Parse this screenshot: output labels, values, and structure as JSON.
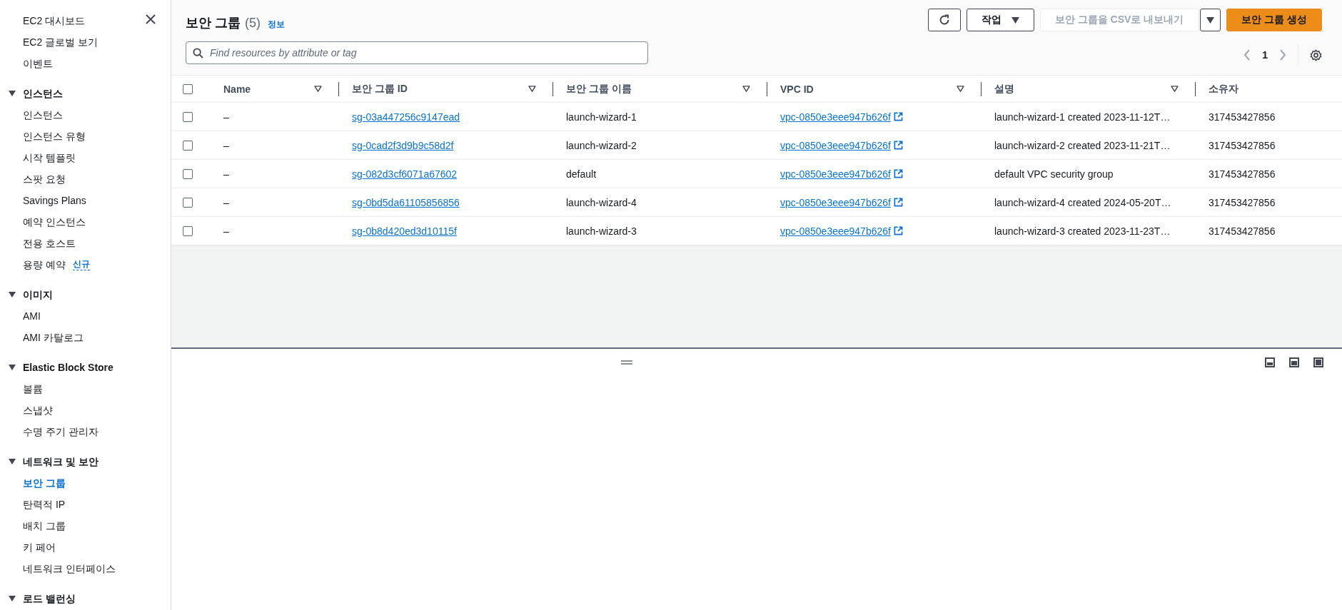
{
  "sidebar": {
    "top_items": [
      {
        "label": "EC2 대시보드",
        "selected": false
      },
      {
        "label": "EC2 글로벌 보기",
        "selected": false
      },
      {
        "label": "이벤트",
        "selected": false
      }
    ],
    "sections": [
      {
        "label": "인스턴스",
        "expanded": true,
        "items": [
          {
            "label": "인스턴스",
            "selected": false
          },
          {
            "label": "인스턴스 유형",
            "selected": false
          },
          {
            "label": "시작 템플릿",
            "selected": false
          },
          {
            "label": "스팟 요청",
            "selected": false
          },
          {
            "label": "Savings Plans",
            "selected": false
          },
          {
            "label": "예약 인스턴스",
            "selected": false
          },
          {
            "label": "전용 호스트",
            "selected": false
          },
          {
            "label": "용량 예약",
            "selected": false,
            "badge": "신규"
          }
        ]
      },
      {
        "label": "이미지",
        "expanded": true,
        "items": [
          {
            "label": "AMI",
            "selected": false
          },
          {
            "label": "AMI 카탈로그",
            "selected": false
          }
        ]
      },
      {
        "label": "Elastic Block Store",
        "expanded": true,
        "items": [
          {
            "label": "볼륨",
            "selected": false
          },
          {
            "label": "스냅샷",
            "selected": false
          },
          {
            "label": "수명 주기 관리자",
            "selected": false
          }
        ]
      },
      {
        "label": "네트워크 및 보안",
        "expanded": true,
        "items": [
          {
            "label": "보안 그룹",
            "selected": true
          },
          {
            "label": "탄력적 IP",
            "selected": false
          },
          {
            "label": "배치 그룹",
            "selected": false
          },
          {
            "label": "키 페어",
            "selected": false
          },
          {
            "label": "네트워크 인터페이스",
            "selected": false
          }
        ]
      },
      {
        "label": "로드 밸런싱",
        "expanded": true
      }
    ]
  },
  "header": {
    "title": "보안 그룹",
    "count": "(5)",
    "info_link": "정보",
    "buttons": [
      {
        "kind": "icon",
        "disabled": false
      },
      {
        "kind": "dropdown",
        "label": "작업",
        "disabled": false
      },
      {
        "kind": "normal",
        "label": "보안 그룹을 CSV로 내보내기",
        "disabled": true
      },
      {
        "kind": "caret",
        "disabled": false
      },
      {
        "kind": "primary",
        "label": "보안 그룹 생성",
        "disabled": false
      }
    ],
    "search": {
      "placeholder": "Find resources by attribute or tag"
    },
    "pagination": {
      "page": "1",
      "prev_disabled": true,
      "next_disabled": true
    }
  },
  "table": {
    "all_checked": false,
    "columns": [
      "Name",
      "보안 그룹 ID",
      "보안 그룹 이름",
      "VPC ID",
      "설명",
      "소유자"
    ],
    "rows": [
      {
        "checked": false,
        "name": "–",
        "id": "sg-03a447256c9147ead",
        "group_name": "launch-wizard-1",
        "vpc": "vpc-0850e3eee947b626f",
        "description": "launch-wizard-1 created 2023-11-12T…",
        "owner": "317453427856"
      },
      {
        "checked": false,
        "name": "–",
        "id": "sg-0cad2f3d9b9c58d2f",
        "group_name": "launch-wizard-2",
        "vpc": "vpc-0850e3eee947b626f",
        "description": "launch-wizard-2 created 2023-11-21T…",
        "owner": "317453427856"
      },
      {
        "checked": false,
        "name": "–",
        "id": "sg-082d3cf6071a67602",
        "group_name": "default",
        "vpc": "vpc-0850e3eee947b626f",
        "description": "default VPC security group",
        "owner": "317453427856"
      },
      {
        "checked": false,
        "name": "–",
        "id": "sg-0bd5da61105856856",
        "group_name": "launch-wizard-4",
        "vpc": "vpc-0850e3eee947b626f",
        "description": "launch-wizard-4 created 2024-05-20T…",
        "owner": "317453427856"
      },
      {
        "checked": false,
        "name": "–",
        "id": "sg-0b8d420ed3d10115f",
        "group_name": "launch-wizard-3",
        "vpc": "vpc-0850e3eee947b626f",
        "description": "launch-wizard-3 created 2023-11-23T…",
        "owner": "317453427856"
      }
    ]
  }
}
